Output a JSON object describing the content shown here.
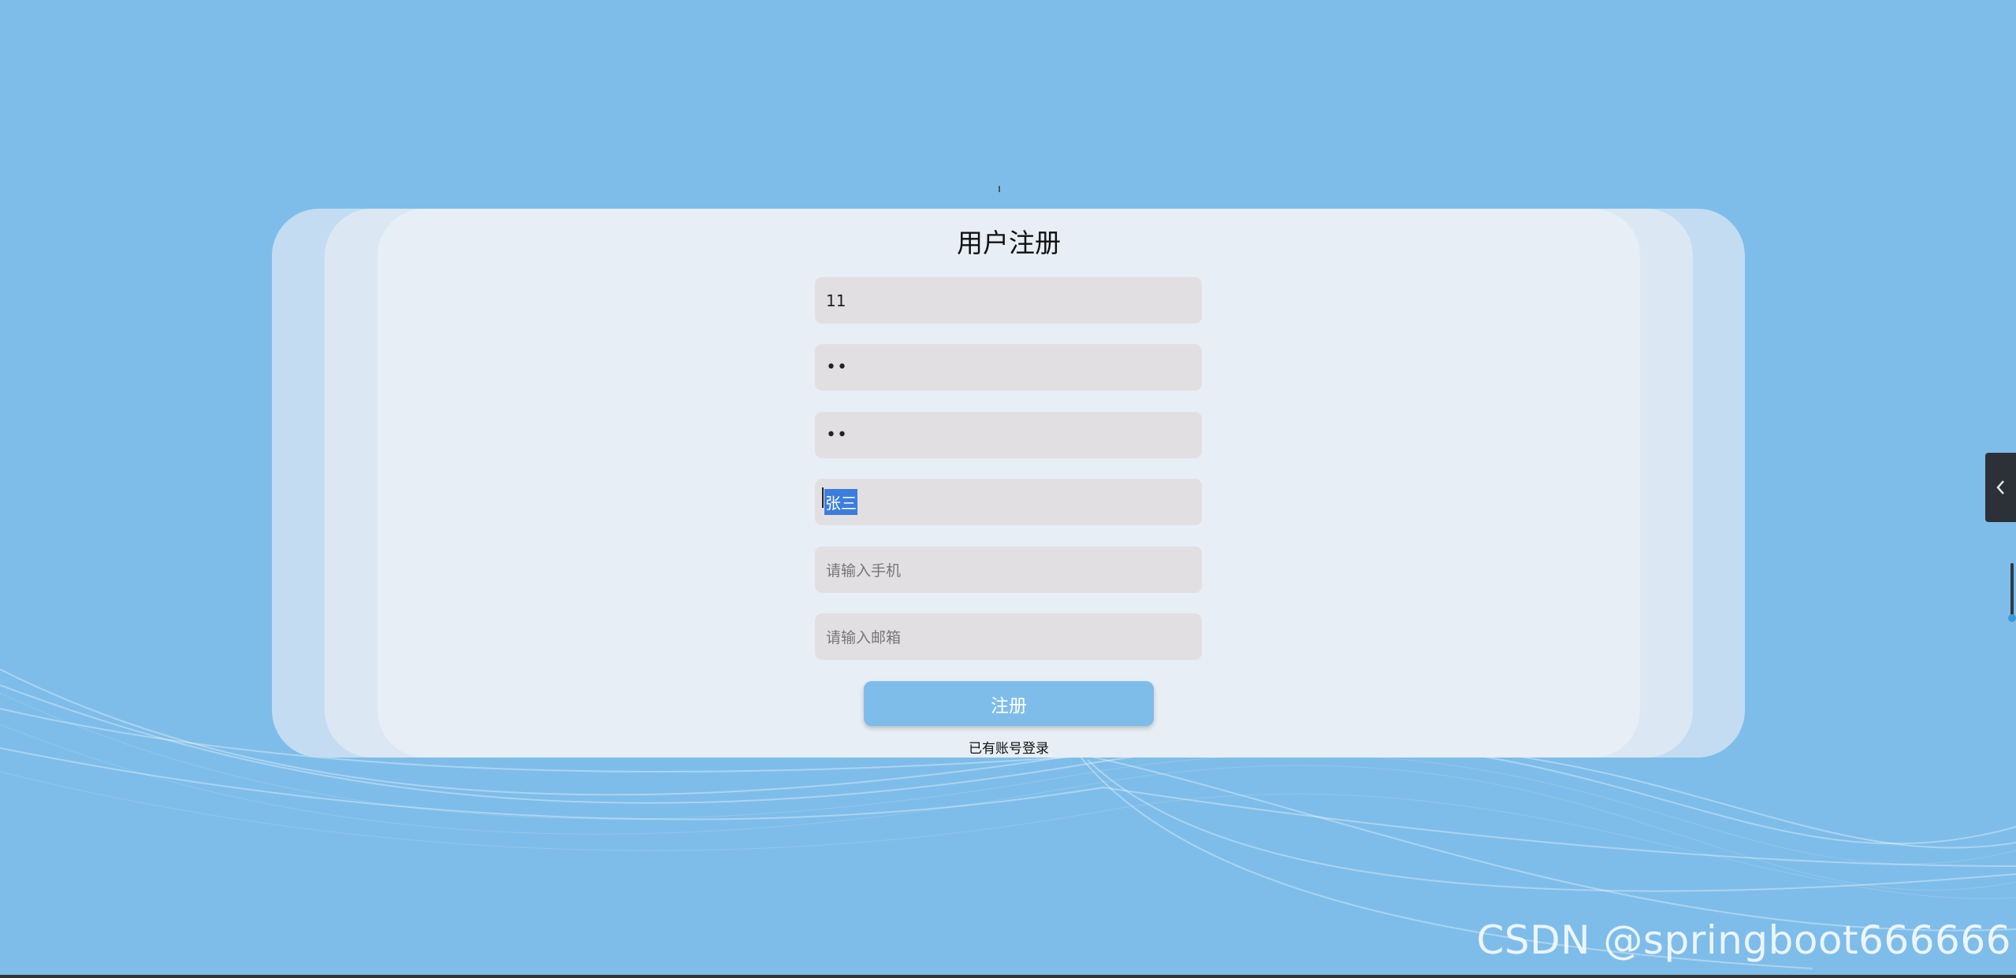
{
  "form": {
    "title": "用户注册",
    "fields": [
      {
        "name": "username",
        "value": "11",
        "placeholder": ""
      },
      {
        "name": "password",
        "value": "••",
        "placeholder": ""
      },
      {
        "name": "confirm_password",
        "value": "••",
        "placeholder": ""
      },
      {
        "name": "real_name",
        "value": "张三",
        "placeholder": ""
      },
      {
        "name": "phone",
        "value": "",
        "placeholder": "请输入手机"
      },
      {
        "name": "email",
        "value": "",
        "placeholder": "请输入邮箱"
      }
    ],
    "submit_label": "注册",
    "login_link": "已有账号登录"
  },
  "side_tab": {
    "icon": "chevron-left-icon"
  },
  "watermark": "CSDN @springboot666666",
  "colors": {
    "background": "#7ebde9",
    "panel": "#e7eef5",
    "input": "#e2dfe2",
    "button": "#7ebde9",
    "selection": "#3b7ddd"
  }
}
